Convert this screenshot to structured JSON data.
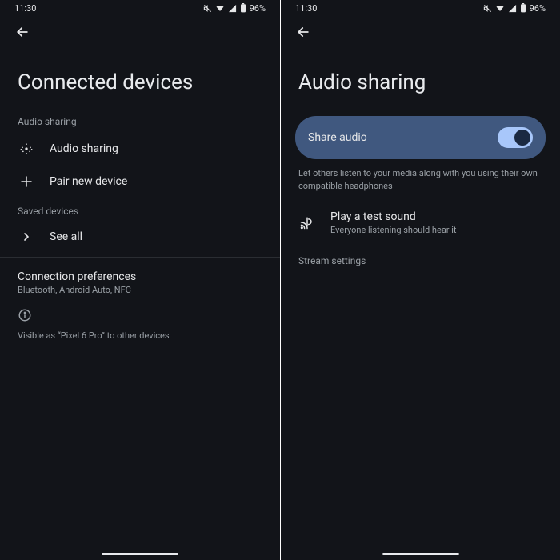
{
  "status": {
    "time": "11:30",
    "battery": "96%"
  },
  "left": {
    "title": "Connected devices",
    "section_audio": "Audio sharing",
    "audio_sharing": "Audio sharing",
    "pair_new": "Pair new device",
    "section_saved": "Saved devices",
    "see_all": "See all",
    "connection_prefs": "Connection preferences",
    "connection_prefs_sub": "Bluetooth, Android Auto, NFC",
    "visible_as": "Visible as “Pixel 6 Pro” to other devices"
  },
  "right": {
    "title": "Audio sharing",
    "share_audio": "Share audio",
    "share_audio_on": true,
    "share_desc": "Let others listen to your media along with you using their own compatible headphones",
    "test_title": "Play a test sound",
    "test_sub": "Everyone listening should hear it",
    "stream_settings": "Stream settings"
  }
}
